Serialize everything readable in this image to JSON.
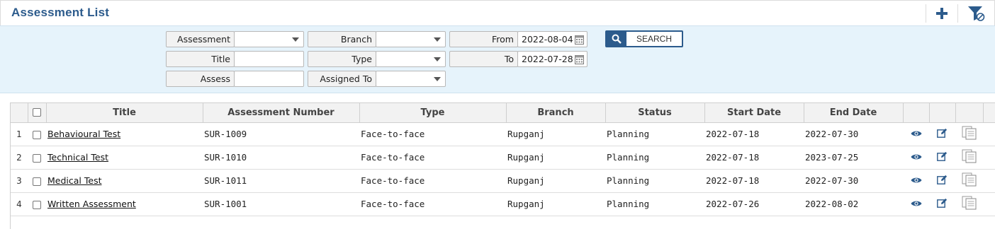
{
  "header": {
    "title": "Assessment List",
    "add_icon": "plus-icon",
    "filter_icon": "filter-clear-icon",
    "accent": "#2c5b8c"
  },
  "filters": {
    "assessment": {
      "label": "Assessment",
      "value": ""
    },
    "branch": {
      "label": "Branch",
      "value": ""
    },
    "from": {
      "label": "From",
      "value": "2022-08-04"
    },
    "title": {
      "label": "Title",
      "value": ""
    },
    "type": {
      "label": "Type",
      "value": ""
    },
    "to": {
      "label": "To",
      "value": "2022-07-28"
    },
    "assess": {
      "label": "Assess",
      "value": ""
    },
    "assigned_to": {
      "label": "Assigned To",
      "value": ""
    },
    "search_label": "SEARCH",
    "background": "#e6f3fb"
  },
  "table": {
    "columns": [
      "Title",
      "Assessment Number",
      "Type",
      "Branch",
      "Status",
      "Start Date",
      "End Date"
    ],
    "rows": [
      {
        "num": "1",
        "title": "Behavioural Test",
        "number": "SUR-1009",
        "type": "Face-to-face",
        "branch": "Rupganj",
        "status": "Planning",
        "start": "2022-07-18",
        "end": "2022-07-30"
      },
      {
        "num": "2",
        "title": "Technical Test",
        "number": "SUR-1010",
        "type": "Face-to-face",
        "branch": "Rupganj",
        "status": "Planning",
        "start": "2022-07-18",
        "end": "2023-07-25"
      },
      {
        "num": "3",
        "title": "Medical Test",
        "number": "SUR-1011",
        "type": "Face-to-face",
        "branch": "Rupganj",
        "status": "Planning",
        "start": "2022-07-18",
        "end": "2022-07-30"
      },
      {
        "num": "4",
        "title": "Written Assessment",
        "number": "SUR-1001",
        "type": "Face-to-face",
        "branch": "Rupganj",
        "status": "Planning",
        "start": "2022-07-26",
        "end": "2022-08-02"
      }
    ],
    "row_icons": [
      "eye-icon",
      "edit-icon",
      "copy-icon"
    ]
  }
}
